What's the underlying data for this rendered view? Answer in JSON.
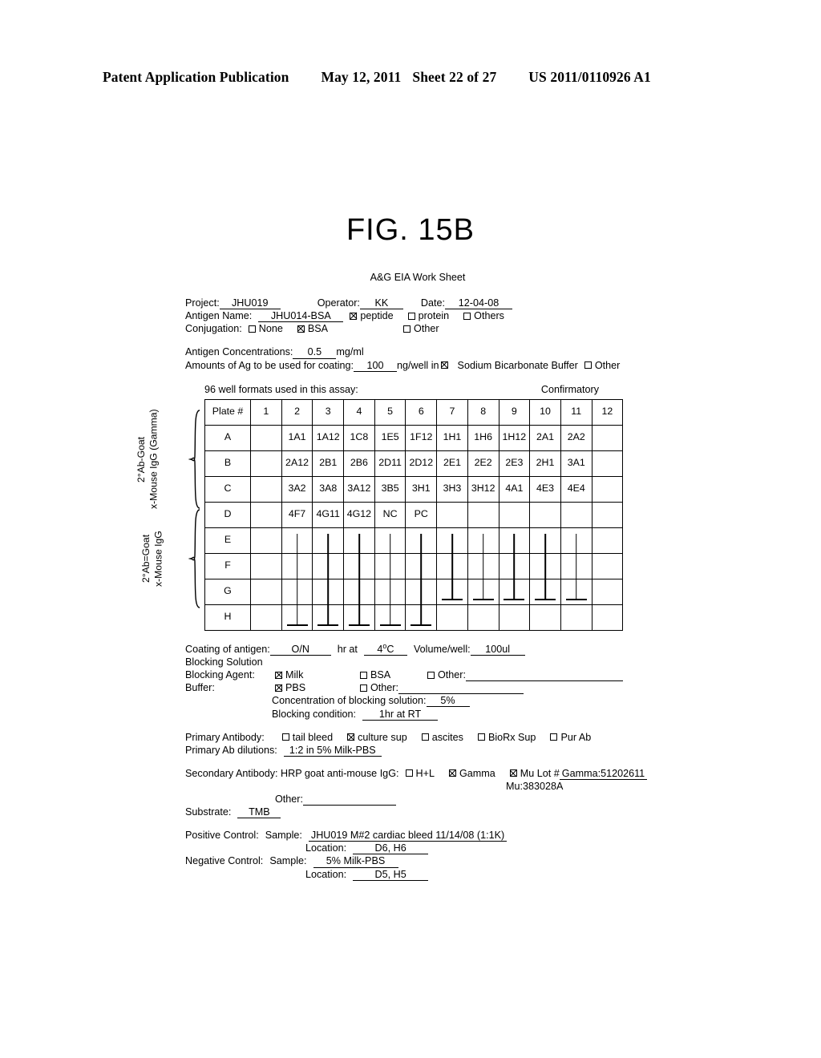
{
  "patent_header": {
    "publication": "Patent Application Publication",
    "date": "May 12, 2011",
    "sheet": "Sheet 22 of 27",
    "number": "US 2011/0110926 A1"
  },
  "figure": {
    "title": "FIG. 15B"
  },
  "worksheet": {
    "title": "A&G EIA Work Sheet",
    "project_label": "Project:",
    "project_value": "JHU019",
    "operator_label": "Operator:",
    "operator_value": "KK",
    "date_label": "Date:",
    "date_value": "12-04-08",
    "antigen_name_label": "Antigen Name:",
    "antigen_name_value": "JHU014-BSA",
    "antigen_type_options": [
      {
        "label": "peptide",
        "checked": true
      },
      {
        "label": "protein",
        "checked": false
      },
      {
        "label": "Others",
        "checked": false
      }
    ],
    "conjugation_label": "Conjugation:",
    "conjugation_options": [
      {
        "label": "None",
        "checked": false
      },
      {
        "label": "BSA",
        "checked": true
      },
      {
        "label": "Other",
        "checked": false
      }
    ],
    "antigen_conc_label": "Antigen Concentrations:",
    "antigen_conc_value": "0.5",
    "antigen_conc_unit": "mg/ml",
    "amounts_label": "Amounts of Ag to be used for coating:",
    "amounts_value": "100",
    "amounts_unit": "ng/well in",
    "coating_buffer_options": [
      {
        "label": "Sodium Bicarbonate Buffer",
        "checked": true
      },
      {
        "label": "Other",
        "checked": false
      }
    ]
  },
  "plate": {
    "caption": "96 well formats used in this assay:",
    "confirmatory": "Confirmatory",
    "corner_label": "Plate #",
    "columns": [
      "1",
      "2",
      "3",
      "4",
      "5",
      "6",
      "7",
      "8",
      "9",
      "10",
      "11",
      "12"
    ],
    "rows": [
      {
        "label": "A",
        "cells": [
          "",
          "1A1",
          "1A12",
          "1C8",
          "1E5",
          "1F12",
          "1H1",
          "1H6",
          "1H12",
          "2A1",
          "2A2",
          ""
        ]
      },
      {
        "label": "B",
        "cells": [
          "",
          "2A12",
          "2B1",
          "2B6",
          "2D11",
          "2D12",
          "2E1",
          "2E2",
          "2E3",
          "2H1",
          "3A1",
          ""
        ]
      },
      {
        "label": "C",
        "cells": [
          "",
          "3A2",
          "3A8",
          "3A12",
          "3B5",
          "3H1",
          "3H3",
          "3H12",
          "4A1",
          "4E3",
          "4E4",
          ""
        ]
      },
      {
        "label": "D",
        "cells": [
          "",
          "4F7",
          "4G11",
          "4G12",
          "NC",
          "PC",
          "",
          "",
          "",
          "",
          "",
          ""
        ]
      },
      {
        "label": "E",
        "cells": [
          "",
          "",
          "",
          "",
          "",
          "",
          "",
          "",
          "",
          "",
          "",
          ""
        ]
      },
      {
        "label": "F",
        "cells": [
          "",
          "",
          "",
          "",
          "",
          "",
          "",
          "",
          "",
          "",
          "",
          ""
        ]
      },
      {
        "label": "G",
        "cells": [
          "",
          "",
          "",
          "",
          "",
          "",
          "",
          "",
          "",
          "",
          "",
          ""
        ]
      },
      {
        "label": "H",
        "cells": [
          "",
          "",
          "",
          "",
          "",
          "",
          "",
          "",
          "",
          "",
          "",
          ""
        ]
      }
    ],
    "side_label_top": [
      "2°Ab-Goat",
      "x-Mouse IgG (Gamma)"
    ],
    "side_label_bottom": [
      "2°Ab=Goat",
      "x-Mouse IgG"
    ]
  },
  "protocol": {
    "coating_label": "Coating of antigen:",
    "coating_time": "O/N",
    "coating_time_unit": "hr at",
    "coating_temp": "4",
    "coating_temp_unit": "C",
    "volume_label": "Volume/well:",
    "volume_value": "100ul",
    "blocking_solution_label": "Blocking Solution",
    "blocking_agent_label": "Blocking Agent:",
    "blocking_agent_options": [
      {
        "label": "Milk",
        "checked": true
      },
      {
        "label": "BSA",
        "checked": false
      },
      {
        "label": "Other:",
        "checked": false
      }
    ],
    "buffer_label": "Buffer:",
    "buffer_options": [
      {
        "label": "PBS",
        "checked": true
      },
      {
        "label": "Other:",
        "checked": false
      }
    ],
    "blocking_conc_label": "Concentration of blocking solution:",
    "blocking_conc_value": "5%",
    "blocking_condition_label": "Blocking condition:",
    "blocking_condition_value": "1hr at  RT"
  },
  "primary": {
    "label": "Primary Antibody:",
    "options": [
      {
        "label": "tail bleed",
        "checked": false
      },
      {
        "label": "culture sup",
        "checked": true
      },
      {
        "label": "ascites",
        "checked": false
      },
      {
        "label": "BioRx Sup",
        "checked": false
      },
      {
        "label": "Pur Ab",
        "checked": false
      }
    ],
    "dilutions_label": "Primary Ab dilutions:",
    "dilutions_value": "1:2 in 5% Milk-PBS"
  },
  "secondary": {
    "label": "Secondary Antibody: HRP goat anti-mouse IgG:",
    "options": [
      {
        "label": "H+L",
        "checked": false
      },
      {
        "label": "Gamma",
        "checked": true
      },
      {
        "label": "Mu Lot #",
        "checked": true
      }
    ],
    "lot_gamma": "Gamma:51202611",
    "lot_mu": "Mu:383028A",
    "other_label": "Other:",
    "substrate_label": "Substrate:",
    "substrate_value": "TMB"
  },
  "controls": {
    "positive_label": "Positive Control:",
    "positive_sample_label": "Sample:",
    "positive_sample_value": "JHU019 M#2 cardiac bleed 11/14/08 (1:1K)",
    "positive_location_label": "Location:",
    "positive_location_value": "D6, H6",
    "negative_label": "Negative Control:",
    "negative_sample_label": "Sample:",
    "negative_sample_value": "5% Milk-PBS",
    "negative_location_label": "Location:",
    "negative_location_value": "D5, H5"
  },
  "marks": {
    "group_long_columns": [
      2,
      3,
      4,
      5,
      6
    ],
    "group_short_columns": [
      7,
      8,
      9,
      10,
      11
    ],
    "long_rows": [
      "E",
      "F",
      "G",
      "H"
    ],
    "short_rows": [
      "E",
      "F",
      "G"
    ]
  }
}
